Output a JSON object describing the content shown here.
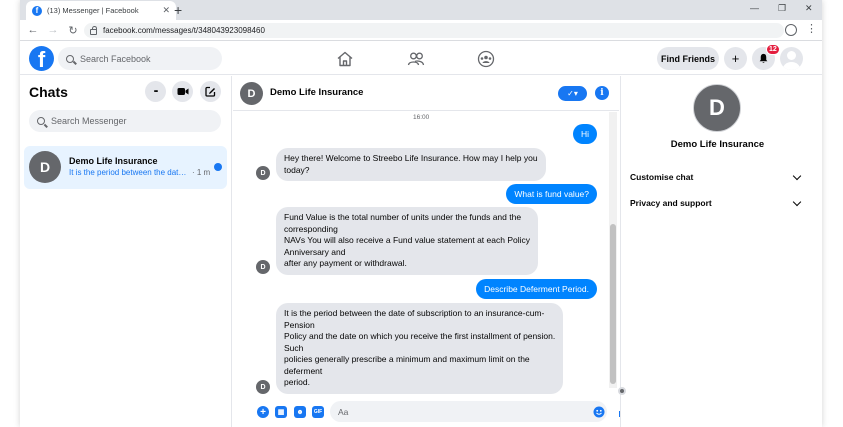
{
  "browser": {
    "tab_title": "(13) Messenger | Facebook",
    "tab_close": "✕",
    "new_tab": "+",
    "url": "facebook.com/messages/t/348043923098460",
    "win_min": "—",
    "win_max": "❐",
    "win_close": "✕"
  },
  "fb_header": {
    "logo_letter": "f",
    "search_placeholder": "Search Facebook",
    "find_friends": "Find Friends",
    "create_glyph": "+",
    "notifications_badge": "12"
  },
  "chats_panel": {
    "title": "Chats",
    "more_glyph": "•••",
    "search_placeholder": "Search Messenger",
    "items": [
      {
        "initial": "D",
        "name": "Demo Life Insurance",
        "preview": "It is the period between the date of subscription to an insurance-cum-Pension",
        "time": "· 1 m"
      }
    ]
  },
  "conversation": {
    "initial": "D",
    "name": "Demo Life Insurance",
    "check_label": "✓▾",
    "info_label": "i",
    "timestamp": "16:00",
    "messages": [
      {
        "dir": "out",
        "text": "Hi"
      },
      {
        "dir": "in",
        "lines": [
          "Hey there! Welcome to Streebo Life Insurance. How may I help you",
          "today?"
        ]
      },
      {
        "dir": "out",
        "text": "What is fund value?"
      },
      {
        "dir": "in",
        "lines": [
          "Fund Value is the total number of units under the funds and the",
          "corresponding",
          "NAVs You will also receive a Fund value statement at each Policy",
          "Anniversary and",
          "after any payment or withdrawal."
        ]
      },
      {
        "dir": "out",
        "text": "Describe Deferment Period."
      },
      {
        "dir": "in",
        "lines": [
          "It is the period between the date of subscription to an insurance-cum-",
          "Pension",
          "Policy and the date on which you receive the first installment of pension.",
          "Such",
          "policies generally prescribe a minimum and maximum limit on the",
          "deferment",
          "period."
        ]
      }
    ],
    "composer_placeholder": "Aa",
    "gif_label": "GIF"
  },
  "info_panel": {
    "initial": "D",
    "name": "Demo Life Insurance",
    "rows": [
      "Customise chat",
      "Privacy and support"
    ]
  },
  "colors": {
    "accent": "#1877f2",
    "bubble_out": "#0084ff",
    "bubble_in": "#e4e6eb",
    "unread_row": "#e7f3ff",
    "badge": "#e41e3f"
  }
}
